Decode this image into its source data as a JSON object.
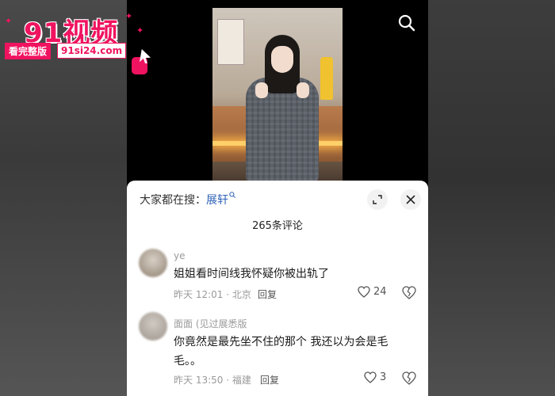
{
  "logo": {
    "title": "91视频",
    "tag": "看完整版",
    "url": "91si24.com"
  },
  "sheet": {
    "search_prefix": "大家都在搜：",
    "search_keyword": "展轩",
    "comment_count": "265条评论"
  },
  "comments": [
    {
      "username": "ye",
      "text": "姐姐看时间线我怀疑你被出轨了",
      "time_location": "昨天 12:01 · 北京",
      "reply_label": "回复",
      "likes": "24"
    },
    {
      "username": "面面 (见过展悉版",
      "text": "你竟然是最先坐不住的那个 我还以为会是毛毛。。",
      "time_location": "昨天 13:50 · 福建",
      "reply_label": "回复",
      "likes": "3"
    }
  ],
  "colors": {
    "brand": "#f0135f",
    "keyword": "#2f63b8"
  },
  "icons": [
    "search-icon",
    "expand-icon",
    "close-icon",
    "heart-icon",
    "broken-heart-icon"
  ]
}
